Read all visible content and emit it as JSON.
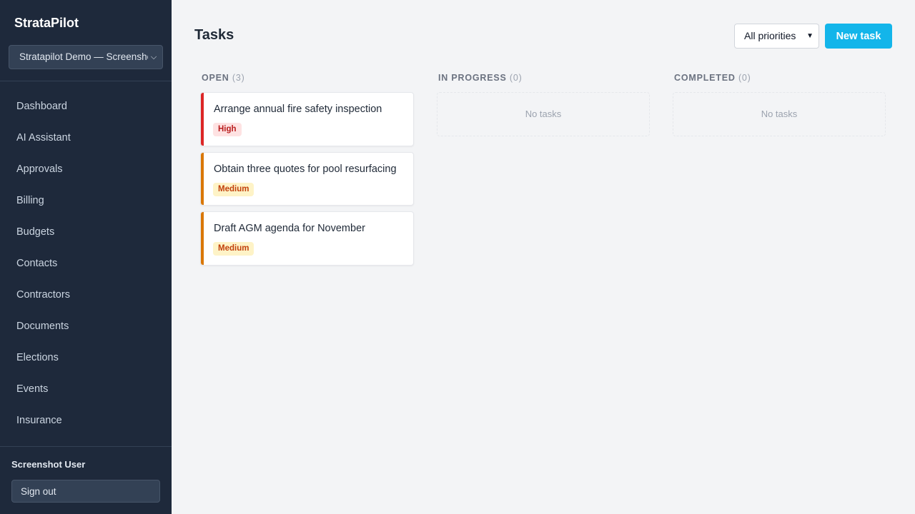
{
  "app": {
    "brand": "StrataPilot",
    "org_selector": "Stratapilot Demo — Screenshot"
  },
  "sidebar": {
    "items": [
      {
        "label": "Dashboard"
      },
      {
        "label": "AI Assistant"
      },
      {
        "label": "Approvals"
      },
      {
        "label": "Billing"
      },
      {
        "label": "Budgets"
      },
      {
        "label": "Contacts"
      },
      {
        "label": "Contractors"
      },
      {
        "label": "Documents"
      },
      {
        "label": "Elections"
      },
      {
        "label": "Events"
      },
      {
        "label": "Insurance"
      }
    ],
    "user_name": "Screenshot User",
    "sign_out_label": "Sign out"
  },
  "header": {
    "title": "Tasks",
    "priority_filter": "All priorities",
    "new_task_label": "New task"
  },
  "columns": [
    {
      "label": "OPEN",
      "count": "(3)"
    },
    {
      "label": "IN PROGRESS",
      "count": "(0)",
      "empty": "No tasks"
    },
    {
      "label": "COMPLETED",
      "count": "(0)",
      "empty": "No tasks"
    }
  ],
  "tasks": [
    {
      "title": "Arrange annual fire safety inspection",
      "priority": "High"
    },
    {
      "title": "Obtain three quotes for pool resurfacing",
      "priority": "Medium"
    },
    {
      "title": "Draft AGM agenda for November",
      "priority": "Medium"
    }
  ],
  "colors": {
    "sidebar_bg": "#1e293b",
    "accent": "#13b5ea",
    "priority_high": "#dc2626",
    "priority_medium": "#d97706"
  }
}
